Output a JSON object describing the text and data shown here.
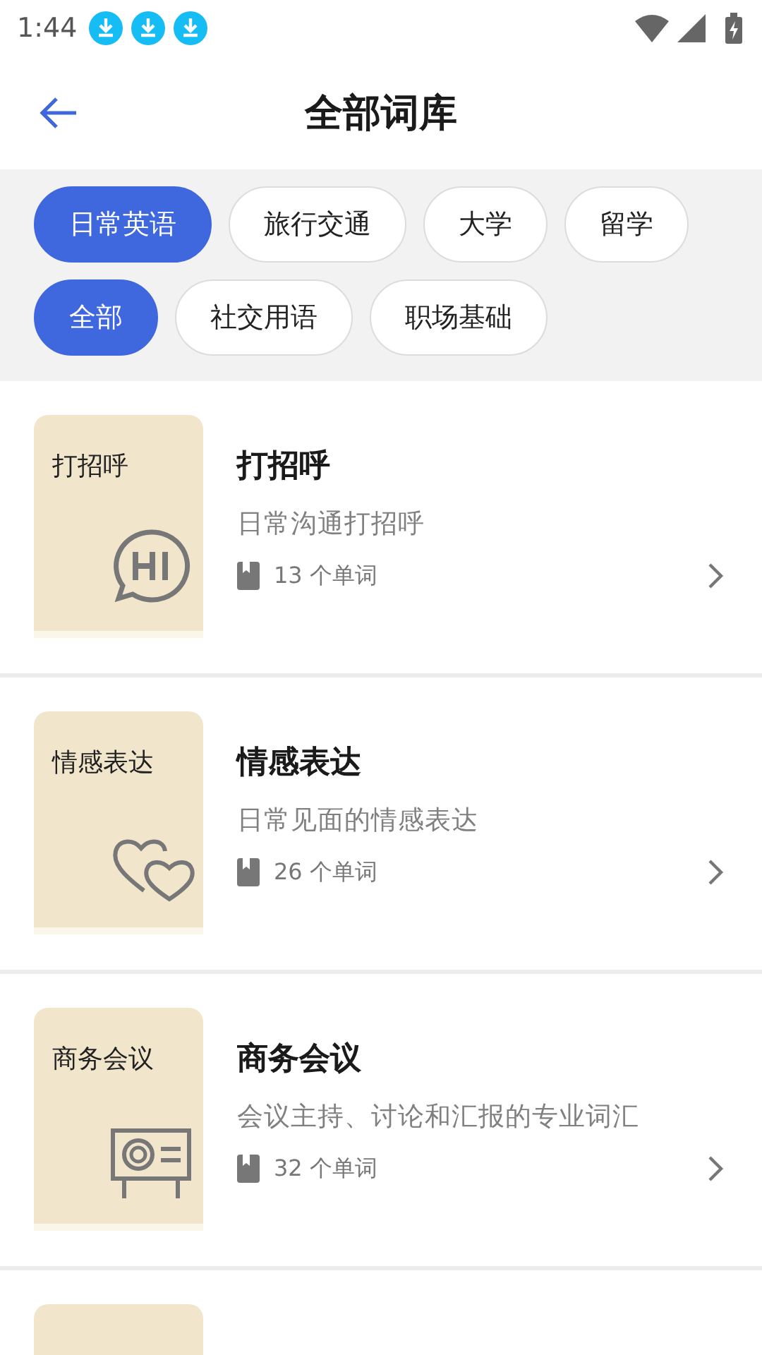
{
  "status_bar": {
    "time": "1:44",
    "notifications": [
      {
        "kind": "download"
      },
      {
        "kind": "download"
      },
      {
        "kind": "download"
      }
    ]
  },
  "header": {
    "title": "全部词库"
  },
  "category_filters": [
    {
      "label": "日常英语",
      "selected": true
    },
    {
      "label": "旅行交通",
      "selected": false
    },
    {
      "label": "大学",
      "selected": false
    },
    {
      "label": "留学",
      "selected": false
    }
  ],
  "subcategory_filters": [
    {
      "label": "全部",
      "selected": true
    },
    {
      "label": "社交用语",
      "selected": false
    },
    {
      "label": "职场基础",
      "selected": false
    }
  ],
  "word_lists": [
    {
      "cover_label": "打招呼",
      "kind": "hi",
      "title": "打招呼",
      "description": "日常沟通打招呼",
      "count": "13 个单词"
    },
    {
      "cover_label": "情感表达",
      "kind": "hearts",
      "title": "情感表达",
      "description": "日常见面的情感表达",
      "count": "26 个单词"
    },
    {
      "cover_label": "商务会议",
      "kind": "board",
      "title": "商务会议",
      "description": "会议主持、讨论和汇报的专业词汇",
      "count": "32 个单词"
    },
    {
      "kind": "blank"
    }
  ]
}
